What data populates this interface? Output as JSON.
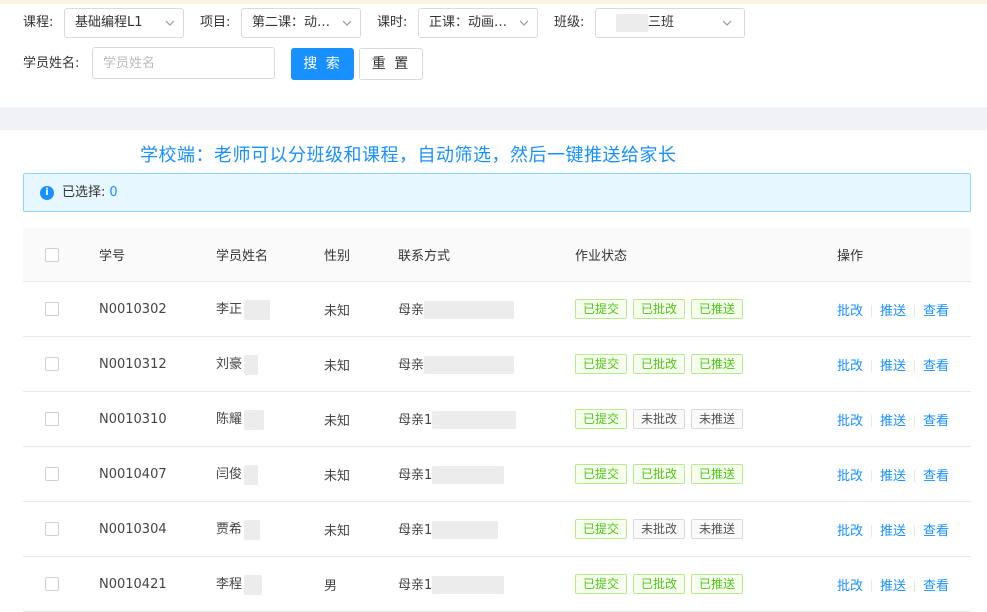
{
  "filters": {
    "course": {
      "label": "课程:",
      "value": "基础编程L1"
    },
    "project": {
      "label": "项目:",
      "value": "第二课：动…"
    },
    "lesson": {
      "label": "课时:",
      "value": "正课：动画…"
    },
    "class": {
      "label": "班级:",
      "value": "三班"
    },
    "student_name": {
      "label": "学员姓名:",
      "placeholder": "学员姓名",
      "value": ""
    }
  },
  "buttons": {
    "search": "搜 索",
    "reset": "重 置"
  },
  "headline": "学校端：老师可以分班级和课程，自动筛选，然后一键推送给家长",
  "alert": {
    "text": "已选择:",
    "count": "0"
  },
  "table": {
    "headers": [
      "学号",
      "学员姓名",
      "性别",
      "联系方式",
      "作业状态",
      "操作"
    ],
    "rows": [
      {
        "id": "N0010302",
        "name": "李正",
        "gender": "未知",
        "contact": "母亲",
        "tags": [
          {
            "text": "已提交",
            "style": "green"
          },
          {
            "text": "已批改",
            "style": "green"
          },
          {
            "text": "已推送",
            "style": "green"
          }
        ]
      },
      {
        "id": "N0010312",
        "name": "刘豪",
        "gender": "未知",
        "contact": "母亲",
        "tags": [
          {
            "text": "已提交",
            "style": "green"
          },
          {
            "text": "已批改",
            "style": "green"
          },
          {
            "text": "已推送",
            "style": "green"
          }
        ]
      },
      {
        "id": "N0010310",
        "name": "陈耀",
        "gender": "未知",
        "contact": "母亲1",
        "tags": [
          {
            "text": "已提交",
            "style": "green"
          },
          {
            "text": "未批改",
            "style": "gray"
          },
          {
            "text": "未推送",
            "style": "gray"
          }
        ]
      },
      {
        "id": "N0010407",
        "name": "闫俊",
        "gender": "未知",
        "contact": "母亲1",
        "tags": [
          {
            "text": "已提交",
            "style": "green"
          },
          {
            "text": "已批改",
            "style": "green"
          },
          {
            "text": "已推送",
            "style": "green"
          }
        ]
      },
      {
        "id": "N0010304",
        "name": "贾希",
        "gender": "未知",
        "contact": "母亲1",
        "tags": [
          {
            "text": "已提交",
            "style": "green"
          },
          {
            "text": "未批改",
            "style": "gray"
          },
          {
            "text": "未推送",
            "style": "gray"
          }
        ]
      },
      {
        "id": "N0010421",
        "name": "李程",
        "gender": "男",
        "contact": "母亲1",
        "tags": [
          {
            "text": "已提交",
            "style": "green"
          },
          {
            "text": "已批改",
            "style": "green"
          },
          {
            "text": "已推送",
            "style": "green"
          }
        ]
      }
    ],
    "actions": [
      "批改",
      "推送",
      "查看"
    ]
  }
}
